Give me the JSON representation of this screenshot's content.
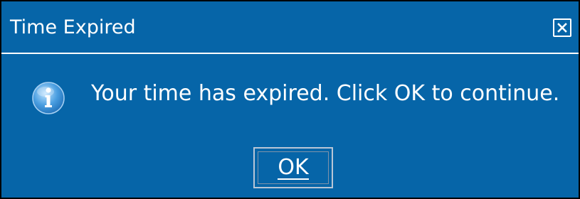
{
  "dialog": {
    "title": "Time Expired",
    "message": "Your time has expired. Click OK to continue.",
    "ok_label": "OK",
    "icons": {
      "close": "close-icon",
      "info": "info-icon"
    },
    "colors": {
      "background": "#0665a8",
      "text": "#ffffff",
      "border": "#000000"
    }
  }
}
